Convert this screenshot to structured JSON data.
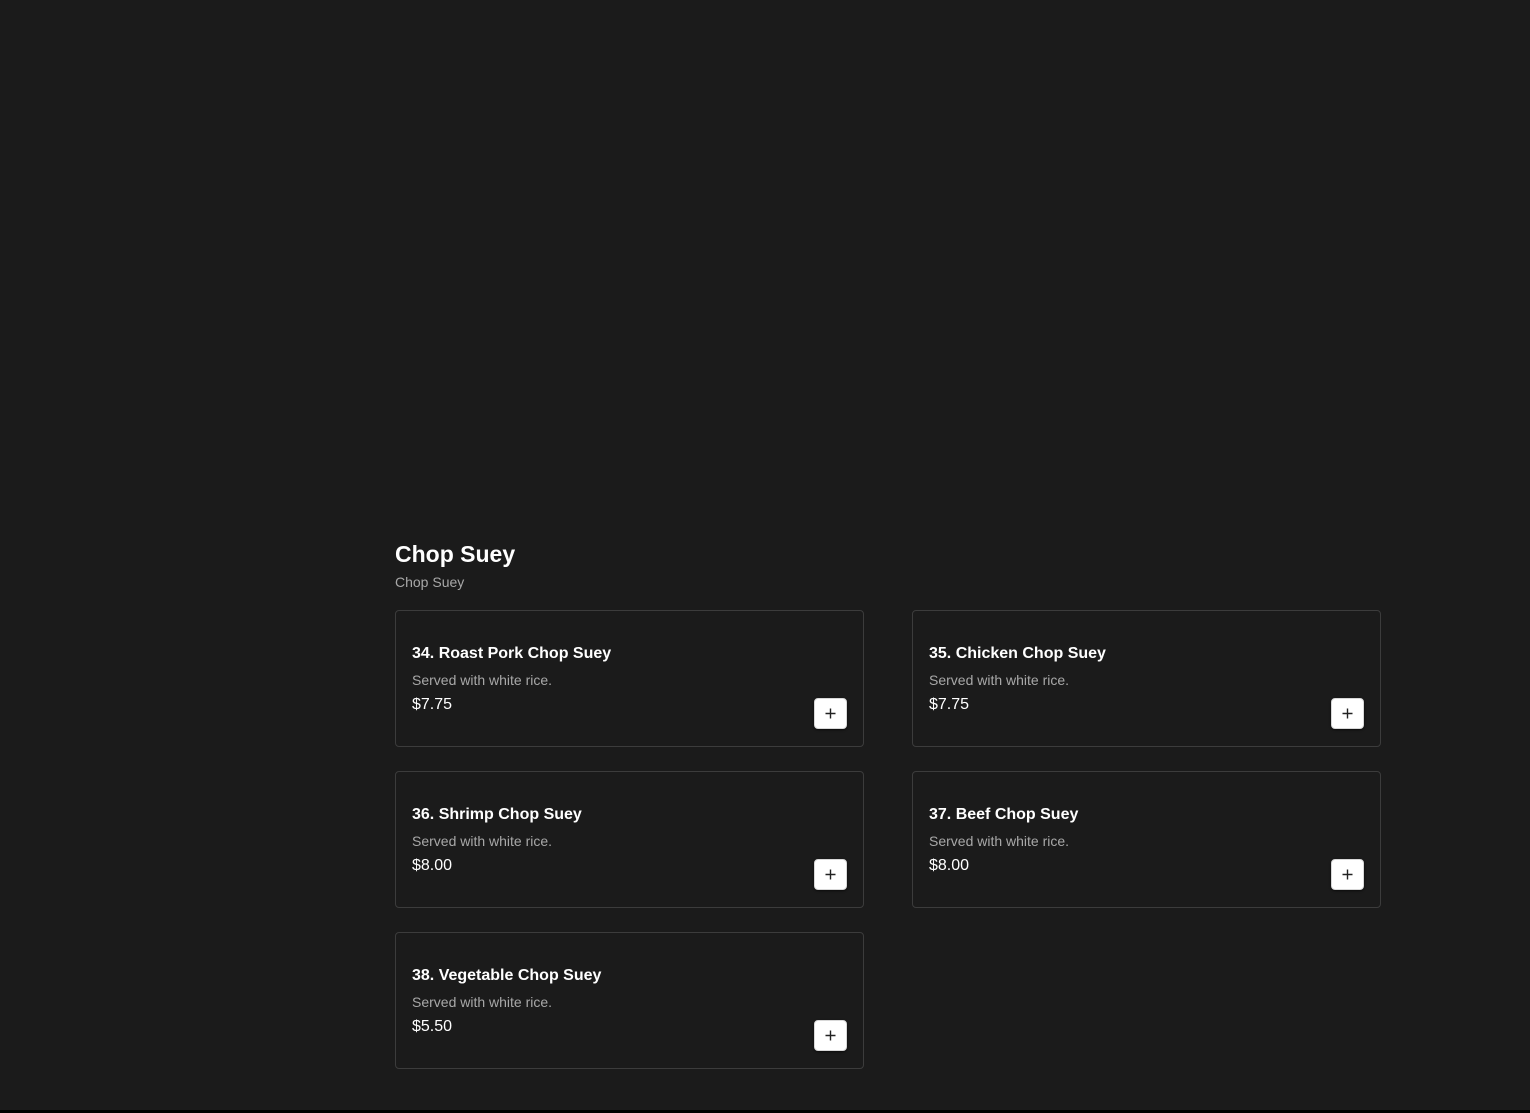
{
  "section": {
    "title": "Chop Suey",
    "subtitle": "Chop Suey"
  },
  "items": [
    {
      "name": "34. Roast Pork Chop Suey",
      "description": "Served with white rice.",
      "price": "$7.75",
      "add_icon": "plus-icon"
    },
    {
      "name": "35. Chicken Chop Suey",
      "description": "Served with white rice.",
      "price": "$7.75",
      "add_icon": "plus-icon"
    },
    {
      "name": "36. Shrimp Chop Suey",
      "description": "Served with white rice.",
      "price": "$8.00",
      "add_icon": "plus-icon"
    },
    {
      "name": "37. Beef Chop Suey",
      "description": "Served with white rice.",
      "price": "$8.00",
      "add_icon": "plus-icon"
    },
    {
      "name": "38. Vegetable Chop Suey",
      "description": "Served with white rice.",
      "price": "$5.50",
      "add_icon": "plus-icon"
    }
  ],
  "colors": {
    "background": "#1b1b1b",
    "card_border": "#3c3c3c",
    "text_primary": "#ffffff",
    "text_secondary": "#a8a8a8",
    "button_background": "#ffffff"
  }
}
